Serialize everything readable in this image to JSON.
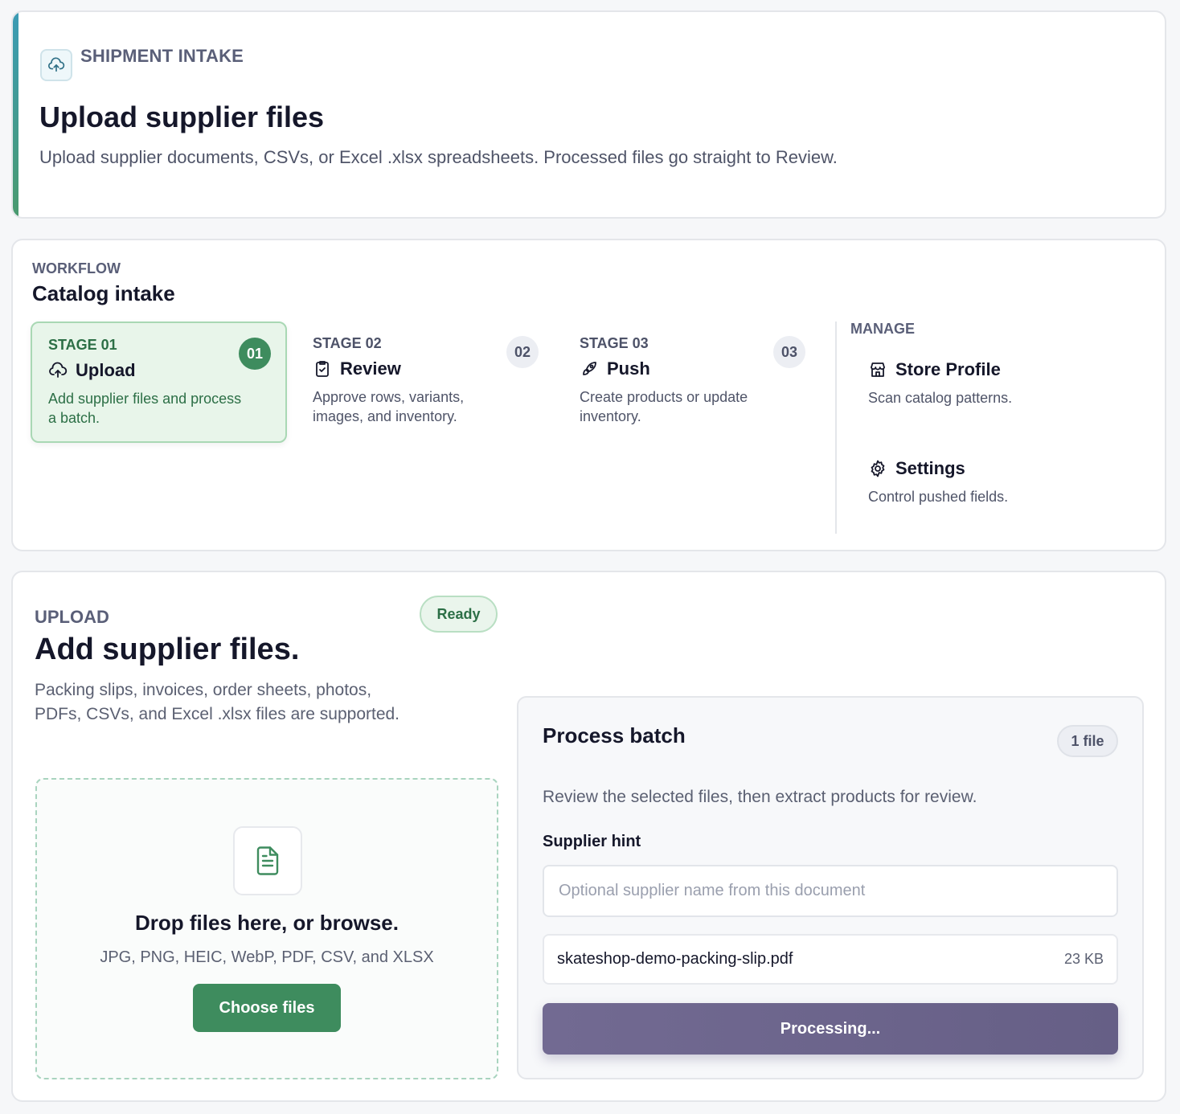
{
  "header": {
    "eyebrow": "SHIPMENT INTAKE",
    "title": "Upload supplier files",
    "subtitle": "Upload supplier documents, CSVs, or Excel .xlsx spreadsheets. Processed files go straight to Review.",
    "icon": "cloud-upload-icon"
  },
  "workflow": {
    "eyebrow": "WORKFLOW",
    "title": "Catalog intake",
    "stages": [
      {
        "label": "STAGE 01",
        "number": "01",
        "name": "Upload",
        "description": "Add supplier files and process a batch.",
        "icon": "cloud-upload-icon",
        "active": true
      },
      {
        "label": "STAGE 02",
        "number": "02",
        "name": "Review",
        "description": "Approve rows, variants, images, and inventory.",
        "icon": "clipboard-check-icon",
        "active": false
      },
      {
        "label": "STAGE 03",
        "number": "03",
        "name": "Push",
        "description": "Create products or update inventory.",
        "icon": "rocket-icon",
        "active": false
      }
    ],
    "manage": {
      "eyebrow": "MANAGE",
      "items": [
        {
          "name": "Store Profile",
          "description": "Scan catalog patterns.",
          "icon": "store-icon"
        },
        {
          "name": "Settings",
          "description": "Control pushed fields.",
          "icon": "gear-icon"
        }
      ]
    }
  },
  "upload": {
    "eyebrow": "UPLOAD",
    "title": "Add supplier files.",
    "description": "Packing slips, invoices, order sheets, photos, PDFs, CSVs, and Excel .xlsx files are supported.",
    "status_badge": "Ready",
    "dropzone": {
      "title": "Drop files here, or browse.",
      "types": "JPG, PNG, HEIC, WebP, PDF, CSV, and XLSX",
      "button": "Choose files",
      "icon": "document-icon"
    },
    "batch": {
      "title": "Process batch",
      "count": "1 file",
      "description": "Review the selected files, then extract products for review.",
      "hint_label": "Supplier hint",
      "hint_placeholder": "Optional supplier name from this document",
      "hint_value": "",
      "files": [
        {
          "name": "skateshop-demo-packing-slip.pdf",
          "size": "23 KB"
        }
      ],
      "process_button": "Processing..."
    }
  },
  "colors": {
    "accent_green": "#3e8c5e",
    "accent_teal": "#3b9bb5",
    "process_purple": "#6d6690",
    "active_stage_bg": "#e8f5ea"
  }
}
